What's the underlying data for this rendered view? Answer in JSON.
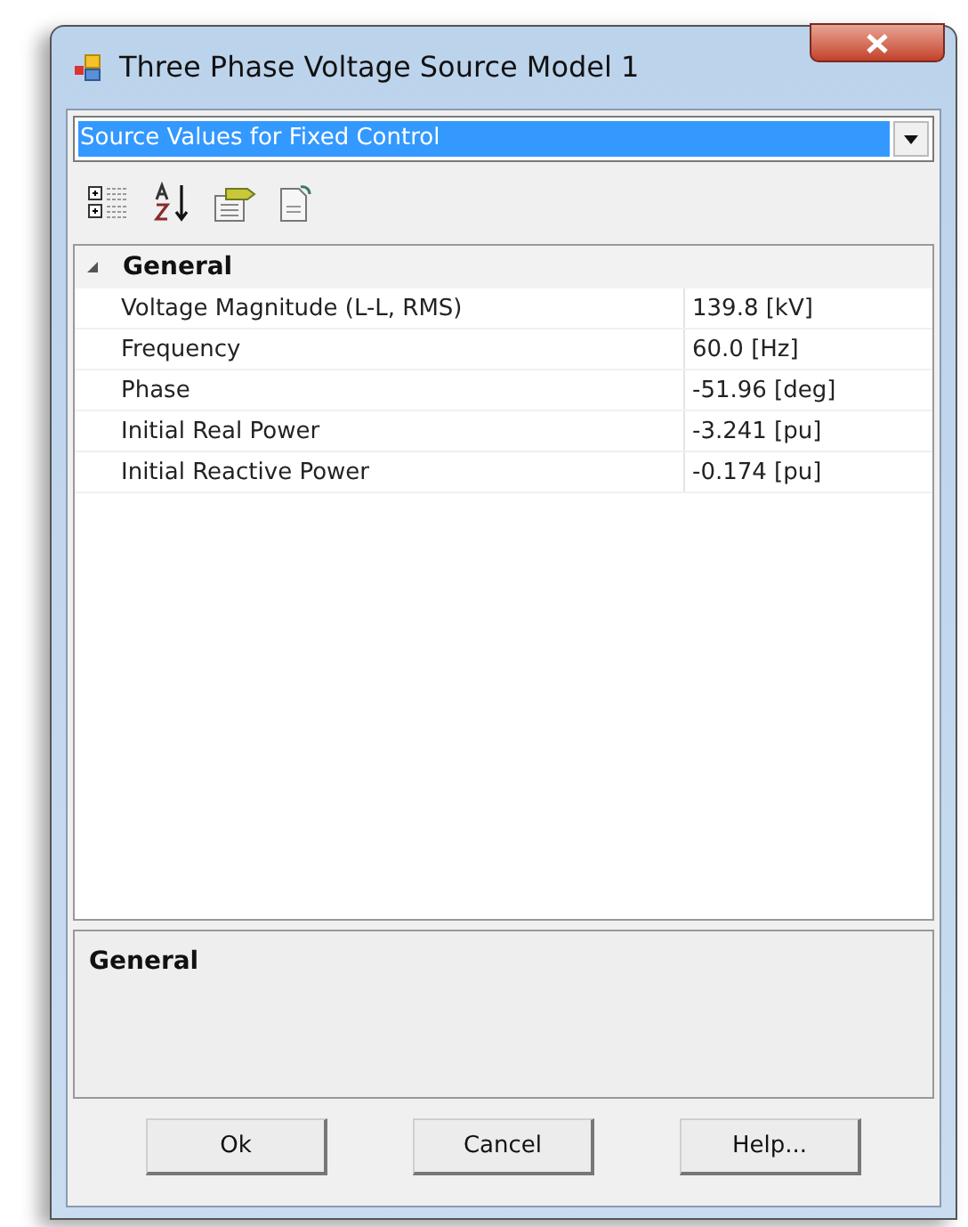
{
  "window": {
    "title": "Three Phase Voltage Source Model 1"
  },
  "selector": {
    "value": "Source Values for Fixed Control"
  },
  "category": {
    "name": "General",
    "expanded": true,
    "properties": [
      {
        "name": "Voltage Magnitude (L-L, RMS)",
        "value": "139.8 [kV]"
      },
      {
        "name": "Frequency",
        "value": "60.0 [Hz]"
      },
      {
        "name": "Phase",
        "value": "-51.96 [deg]"
      },
      {
        "name": "Initial Real Power",
        "value": "-3.241 [pu]"
      },
      {
        "name": "Initial Reactive Power",
        "value": "-0.174 [pu]"
      }
    ]
  },
  "description": {
    "title": "General"
  },
  "buttons": [
    "Ok",
    "Cancel",
    "Help..."
  ]
}
